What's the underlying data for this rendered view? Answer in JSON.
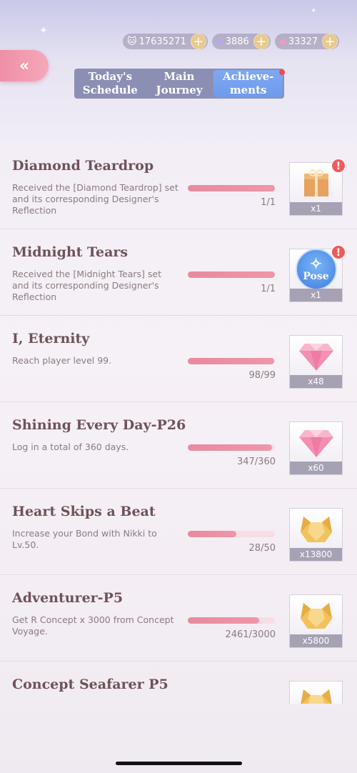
{
  "currencies": [
    {
      "icon": "cat-coin-icon",
      "value": "17635271"
    },
    {
      "icon": "purple-diamond-icon",
      "value": "3886"
    },
    {
      "icon": "pink-diamond-icon",
      "value": "33327"
    }
  ],
  "tabs": [
    {
      "label": "Today's Schedule",
      "line1": "Today's",
      "line2": "Schedule"
    },
    {
      "label": "Main Journey",
      "line1": "Main",
      "line2": "Journey"
    },
    {
      "label": "Achievements",
      "line1": "Achieve-",
      "line2": "ments",
      "active": true
    }
  ],
  "achievements": [
    {
      "title": "Diamond Teardrop",
      "desc": "Received the [Diamond Teardrop] set and its corresponding Designer's Reflection",
      "progress": "1/1",
      "ratio": 1.0,
      "reward": "gift-box-icon",
      "qty": "x1",
      "alert": true
    },
    {
      "title": "Midnight Tears",
      "desc": "Received the [Midnight Tears] set and its corresponding Designer's Reflection",
      "progress": "1/1",
      "ratio": 1.0,
      "reward": "pose-icon",
      "reward_label": "Pose",
      "qty": "x1",
      "alert": true
    },
    {
      "title": "I, Eternity",
      "desc": "Reach player level 99.",
      "progress": "98/99",
      "ratio": 0.99,
      "reward": "pink-diamond-icon",
      "qty": "x48",
      "alert": false
    },
    {
      "title": "Shining Every Day-P26",
      "desc": "Log in a total of 360 days.",
      "progress": "347/360",
      "ratio": 0.964,
      "reward": "pink-diamond-icon",
      "qty": "x60",
      "alert": false
    },
    {
      "title": "Heart Skips a Beat",
      "desc": "Increase your Bond with Nikki to Lv.50.",
      "progress": "28/50",
      "ratio": 0.56,
      "reward": "gold-cat-coin-icon",
      "qty": "x13800",
      "alert": false
    },
    {
      "title": "Adventurer-P5",
      "desc": "Get R Concept x 3000 from Concept Voyage.",
      "progress": "2461/3000",
      "ratio": 0.82,
      "reward": "gold-cat-coin-icon",
      "qty": "x5800",
      "alert": false
    },
    {
      "title": "Concept Seafarer P5",
      "desc": "",
      "progress": "",
      "ratio": 0,
      "reward": "gold-cat-coin-icon",
      "qty": "",
      "alert": false
    }
  ],
  "colors": {
    "accent": "#ee8fa5",
    "tab_active": "#6f9bee",
    "tab_bg": "#8c8fb4"
  }
}
